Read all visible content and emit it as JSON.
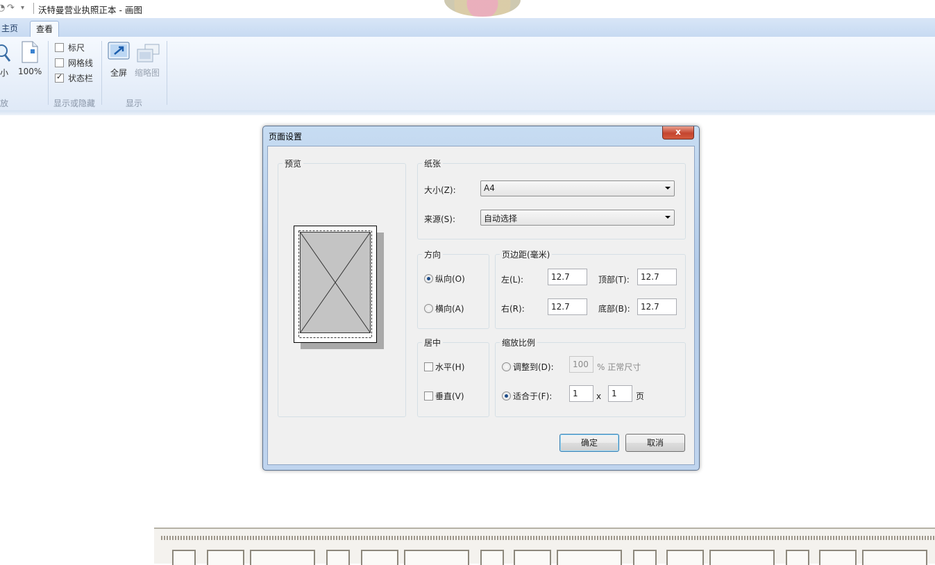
{
  "window": {
    "title": "沃特曼营业执照正本 - 画图",
    "quick_access": [
      "undo-icon",
      "redo-icon",
      "customize-quick-access-icon"
    ]
  },
  "ribbon": {
    "tabs": [
      {
        "label": "主页",
        "active": false
      },
      {
        "label": "查看",
        "active": true
      }
    ],
    "zoom_group": {
      "label": "放",
      "zoom_out_label": "小",
      "actual_size_label": "100%"
    },
    "show_hide_group": {
      "label": "显示或隐藏",
      "ruler": {
        "label": "标尺",
        "checked": false
      },
      "gridlines": {
        "label": "网格线",
        "checked": false
      },
      "statusbar": {
        "label": "状态栏",
        "checked": true
      }
    },
    "display_group": {
      "label": "显示",
      "fullscreen_label": "全屏",
      "thumbnail_label": "缩略图"
    }
  },
  "dialog": {
    "title": "页面设置",
    "close_label": "x",
    "preview": {
      "legend": "预览"
    },
    "paper": {
      "legend": "纸张",
      "size_label": "大小(Z):",
      "size_value": "A4",
      "source_label": "来源(S):",
      "source_value": "自动选择"
    },
    "orientation": {
      "legend": "方向",
      "portrait_label": "纵向(O)",
      "portrait_selected": true,
      "landscape_label": "横向(A)",
      "landscape_selected": false
    },
    "margins": {
      "legend": "页边距(毫米)",
      "left_label": "左(L):",
      "left_value": "12.7",
      "top_label": "顶部(T):",
      "top_value": "12.7",
      "right_label": "右(R):",
      "right_value": "12.7",
      "bottom_label": "底部(B):",
      "bottom_value": "12.7"
    },
    "centering": {
      "legend": "居中",
      "horizontal_label": "水平(H)",
      "horizontal_checked": false,
      "vertical_label": "垂直(V)",
      "vertical_checked": false
    },
    "scaling": {
      "legend": "缩放比例",
      "adjust_label": "调整到(D):",
      "adjust_selected": false,
      "adjust_value": "100",
      "adjust_suffix": "% 正常尺寸",
      "fit_label": "适合于(F):",
      "fit_selected": true,
      "fit_wide": "1",
      "fit_times": "x",
      "fit_tall": "1",
      "fit_suffix": "页"
    },
    "ok_label": "确定",
    "cancel_label": "取消"
  }
}
